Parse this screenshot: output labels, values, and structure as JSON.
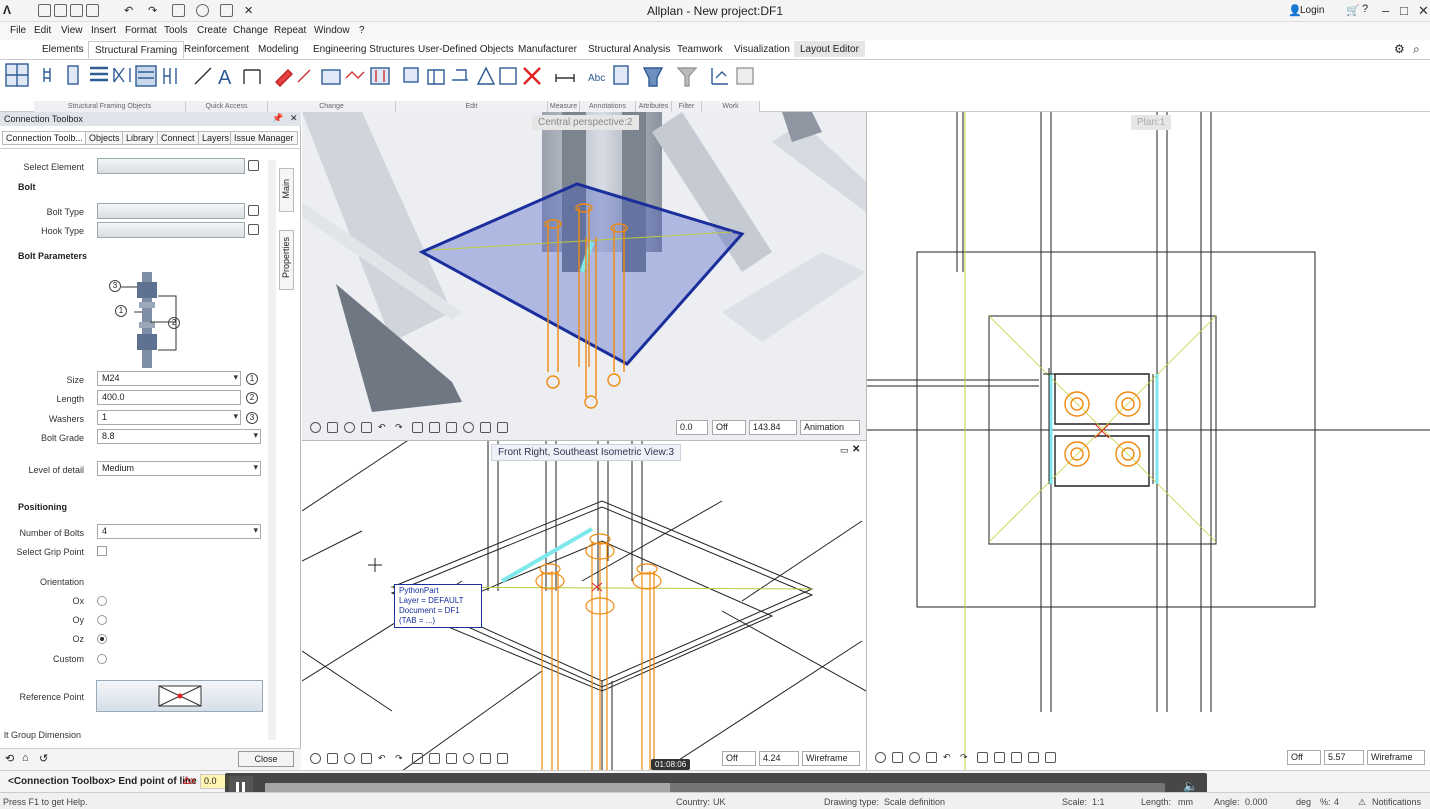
{
  "app": {
    "title": "Allplan - New project:DF1",
    "login": "Login"
  },
  "menu": [
    "File",
    "Edit",
    "View",
    "Insert",
    "Format",
    "Tools",
    "Create",
    "Change",
    "Repeat",
    "Window",
    "?"
  ],
  "ribbon_tabs": [
    "Elements",
    "Structural Framing",
    "Reinforcement",
    "Modeling",
    "Engineering Structures",
    "User-Defined Objects",
    "Manufacturer",
    "Structural Analysis",
    "Teamwork",
    "Visualization",
    "Layout Editor"
  ],
  "ribbon_groups": [
    "Structural Framing Objects",
    "Quick Access",
    "Change",
    "Edit",
    "Measure",
    "Annotations",
    "Attributes",
    "Filter",
    "Work Environment"
  ],
  "panel": {
    "title": "Connection Toolbox",
    "tabs": [
      "Connection Toolb...",
      "Objects",
      "Library",
      "Connect",
      "Layers",
      "Issue Manager"
    ],
    "select_element": "Select Element",
    "bolt_section": "Bolt",
    "bolt_type": "Bolt Type",
    "hook_type": "Hook Type",
    "bolt_params": "Bolt Parameters",
    "size_label": "Size",
    "size": "M24",
    "length_label": "Length",
    "length": "400.0",
    "washers_label": "Washers",
    "washers": "1",
    "grade_label": "Bolt Grade",
    "grade": "8.8",
    "lod_label": "Level of detail",
    "lod": "Medium",
    "positioning": "Positioning",
    "num_bolts_label": "Number of Bolts",
    "num_bolts": "4",
    "grip_label": "Select Grip Point",
    "orientation": "Orientation",
    "ox": "Ox",
    "oy": "Oy",
    "oz": "Oz",
    "custom": "Custom",
    "ref_point": "Reference Point",
    "group_dim": "lt Group Dimension",
    "close": "Close",
    "vtab_main": "Main",
    "vtab_props": "Properties",
    "callouts": [
      "3",
      "1",
      "2"
    ],
    "markers": [
      "1",
      "2",
      "3"
    ]
  },
  "vp1": {
    "label": "Central perspective:2",
    "val1": "0.0",
    "off": "Off",
    "val2": "143.84",
    "mode": "Animation"
  },
  "vp2": {
    "label": "Front Right, Southeast Isometric View:3",
    "off": "Off",
    "val": "4.24",
    "mode": "Wireframe",
    "tooltip": [
      "PythonPart",
      "Layer        = DEFAULT",
      "Document   = DF1",
      "(TAB = ...)"
    ]
  },
  "vp3": {
    "label": "Plan:1",
    "off": "Off",
    "val": "5.57",
    "mode": "Wireframe"
  },
  "cmd": {
    "prompt": "<Connection Toolbox> End point of line",
    "dx": "Δx",
    "val": "0.0"
  },
  "player": {
    "time": "01:08:06"
  },
  "status": {
    "help": "Press F1 to get Help.",
    "country": "Country:",
    "country_val": "UK",
    "drawing_type": "Drawing type:",
    "drawing_val": "Scale definition",
    "scale": "Scale:",
    "scale_val": "1:1",
    "length": "Length:",
    "length_val": "mm",
    "angle": "Angle:",
    "angle_val": "0.000",
    "deg": "deg",
    "pct": "%:",
    "pct_val": "4",
    "notifications": "Notifications"
  },
  "colors": {
    "accent": "#2f6cc0",
    "bolt": "#f08a10",
    "plate": "#3b4fb0"
  }
}
